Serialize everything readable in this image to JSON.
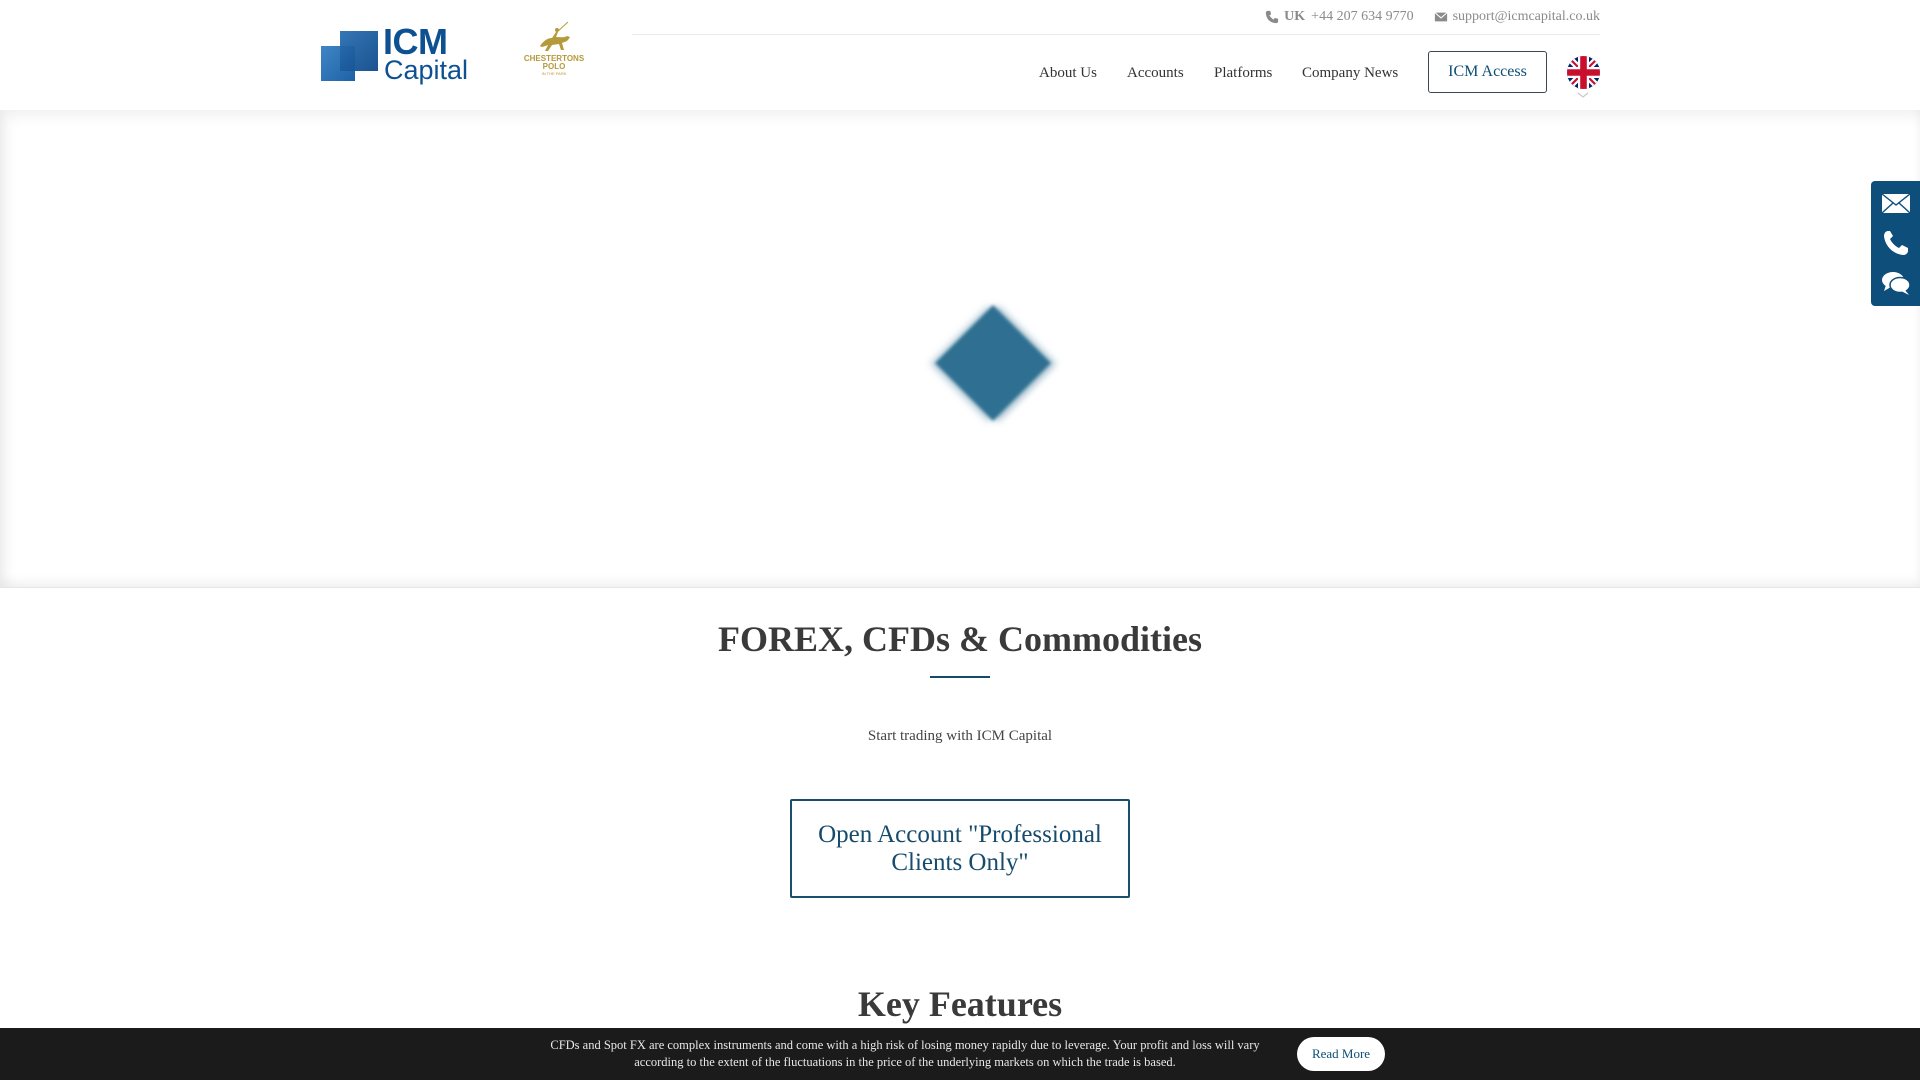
{
  "header": {
    "logo": {
      "primary": "ICM",
      "secondary": "Capital"
    },
    "sponsor_logo": {
      "line1": "CHESTERTONS",
      "line2": "POLO",
      "line3": "IN THE PARK"
    },
    "contact": {
      "phone_icon": "phone-icon",
      "region": "UK",
      "phone": "+44 207 634 9770",
      "email_icon": "envelope-icon",
      "email": "support@icmcapital.co.uk"
    },
    "nav": [
      {
        "label": "About Us"
      },
      {
        "label": "Accounts"
      },
      {
        "label": "Platforms"
      },
      {
        "label": "Company News"
      }
    ],
    "access_button": "ICM Access",
    "language": {
      "icon": "uk-flag-icon",
      "caret": "chevron-down-icon"
    }
  },
  "hero": {
    "loader_icon": "loading-diamond",
    "accent_color": "#2f6f91"
  },
  "main": {
    "heading": "FOREX, CFDs & Commodities",
    "subtext": "Start trading with ICM Capital",
    "cta_button": "Open Account \"Professional Clients Only\"",
    "section_heading": "Key Features"
  },
  "side_widget": {
    "items": [
      {
        "icon": "envelope-icon",
        "label": "Email"
      },
      {
        "icon": "phone-icon",
        "label": "Call"
      },
      {
        "icon": "chat-icon",
        "label": "Chat"
      }
    ],
    "color": "#0e4e7b"
  },
  "risk_warning": {
    "text": "CFDs and Spot FX are complex instruments and come with a high risk of losing money rapidly due to leverage. Your profit and loss will vary according to the extent of the fluctuations in the price of the underlying markets on which the trade is based.",
    "button": "Read More"
  },
  "colors": {
    "brand": "#0d5193",
    "accent": "#174b6b",
    "text": "#333333"
  }
}
